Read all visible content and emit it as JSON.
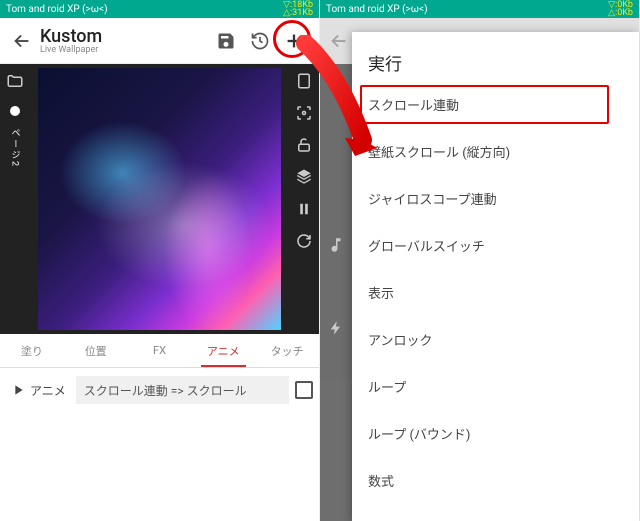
{
  "status": {
    "title": "Tom and roid XP (>ω<)",
    "left_net_down": "▽:18Kb",
    "left_net_up": "△:31Kb",
    "right_net_down": "▽:0Kb",
    "right_net_up": "△:0Kb"
  },
  "header": {
    "title": "Kustom",
    "subtitle": "Live Wallpaper"
  },
  "left_sidebar": {
    "page_label": "ページ2"
  },
  "tabs": [
    {
      "label": "塗り",
      "active": false
    },
    {
      "label": "位置",
      "active": false
    },
    {
      "label": "FX",
      "active": false
    },
    {
      "label": "アニメ",
      "active": true
    },
    {
      "label": "タッチ",
      "active": false
    }
  ],
  "anime_row": {
    "button_label": "アニメ",
    "formula": "スクロール連動 => スクロール"
  },
  "dialog": {
    "title": "実行",
    "items": [
      "スクロール連動",
      "壁紙スクロール (縦方向)",
      "ジャイロスコープ連動",
      "グローバルスイッチ",
      "表示",
      "アンロック",
      "ループ",
      "ループ (バウンド)",
      "数式"
    ],
    "highlight_index": 0
  }
}
